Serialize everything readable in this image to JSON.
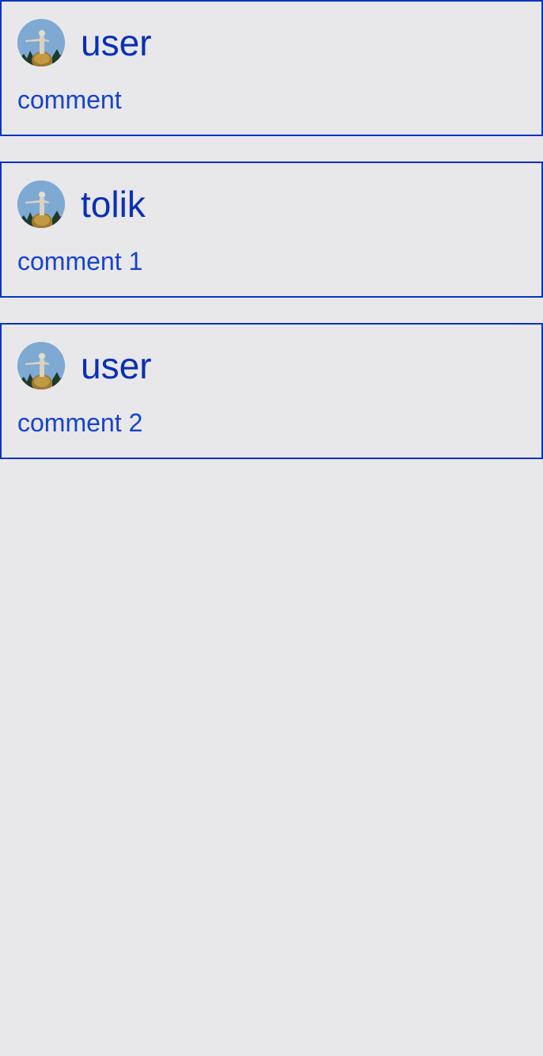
{
  "comments": [
    {
      "username": "user",
      "text": "comment",
      "avatar_icon": "profile-photo"
    },
    {
      "username": "tolik",
      "text": "comment 1",
      "avatar_icon": "profile-photo"
    },
    {
      "username": "user",
      "text": "comment 2",
      "avatar_icon": "profile-photo"
    }
  ],
  "colors": {
    "background": "#e8e7ea",
    "card_border": "#0a34c2",
    "username": "#0a2fb5",
    "comment_text": "#1643cf"
  }
}
